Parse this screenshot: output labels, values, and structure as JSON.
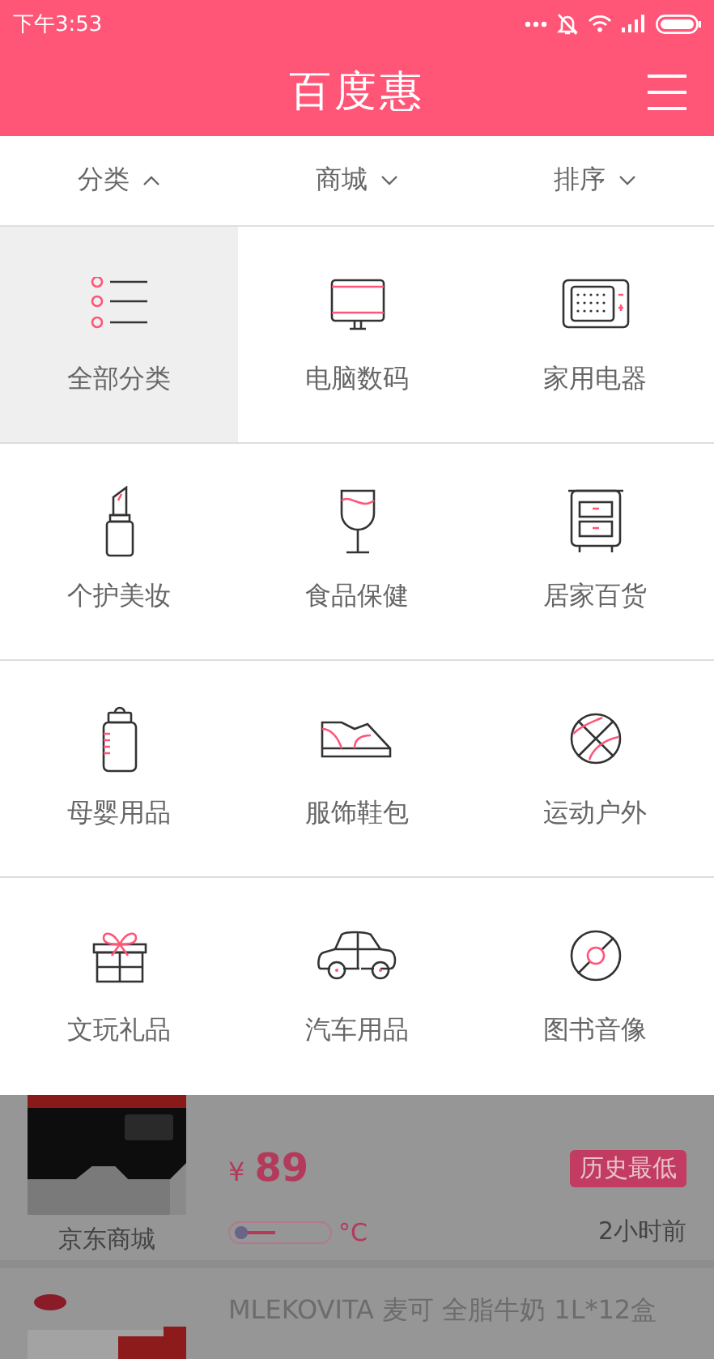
{
  "status_bar": {
    "time": "下午3:53"
  },
  "header": {
    "title": "百度惠"
  },
  "filters": [
    {
      "label": "分类",
      "expanded": true
    },
    {
      "label": "商城",
      "expanded": false
    },
    {
      "label": "排序",
      "expanded": false
    }
  ],
  "categories": [
    {
      "label": "全部分类",
      "selected": true
    },
    {
      "label": "电脑数码",
      "selected": false
    },
    {
      "label": "家用电器",
      "selected": false
    },
    {
      "label": "个护美妆",
      "selected": false
    },
    {
      "label": "食品保健",
      "selected": false
    },
    {
      "label": "居家百货",
      "selected": false
    },
    {
      "label": "母婴用品",
      "selected": false
    },
    {
      "label": "服饰鞋包",
      "selected": false
    },
    {
      "label": "运动户外",
      "selected": false
    },
    {
      "label": "文玩礼品",
      "selected": false
    },
    {
      "label": "汽车用品",
      "selected": false
    },
    {
      "label": "图书音像",
      "selected": false
    }
  ],
  "products": [
    {
      "kind": "full",
      "store": "京东商城",
      "currency": "¥",
      "price": "89",
      "badge": "历史最低",
      "heat": {
        "level": 0.45,
        "unit": "°C"
      },
      "time": "2小时前"
    },
    {
      "kind": "title",
      "title": "MLEKOVITA 麦可 全脂牛奶 1L*12盒"
    }
  ]
}
